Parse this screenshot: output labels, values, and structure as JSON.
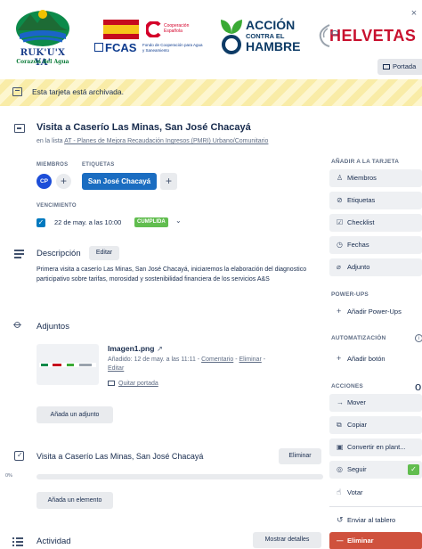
{
  "cover": {
    "logo_rukux_name": "RUK'U'X YA'",
    "logo_rukux_sub": "Corazón del Agua",
    "logo_spain_top": "Cooperación Española",
    "logo_spain_fcas": "FCAS",
    "logo_spain_fcas_sub": "Fondo de Cooperación para Agua y Saneamiento",
    "logo_accion_line1": "ACCIÓN",
    "logo_accion_line2": "CONTRA EL",
    "logo_accion_line3": "HAMBRE",
    "logo_helvetas": "HELVETAS",
    "close_glyph": "×",
    "cover_button": "Portada"
  },
  "archived_banner": "Esta tarjeta está archivada.",
  "card": {
    "title": "Visita a Caserío Las Minas, San José Chacayá",
    "in_list_prefix": "en la lista ",
    "list_name": "AT - Planes de Mejora Recaudación Ingresos (PMRI) Urbano/Comunitario"
  },
  "members": {
    "label": "MIEMBROS",
    "avatar_initials": "CP",
    "add": "+"
  },
  "labels": {
    "label": "ETIQUETAS",
    "tag": "San José Chacayá",
    "tag_color": "#1b6dc1",
    "add": "+"
  },
  "due": {
    "label": "VENCIMIENTO",
    "checked": true,
    "date": "22 de may. a las 10:00",
    "badge": "CUMPLIDA",
    "badge_color": "#61bd4f"
  },
  "description": {
    "title": "Descripción",
    "edit_button": "Editar",
    "text": "Primera visita a caserío Las Minas, San José Chacayá, iniciaremos la elaboración del diagnostico participativo sobre tarifas, morosidad y sostenibilidad financiera de los servicios A&S"
  },
  "attachments": {
    "title": "Adjuntos",
    "file_name": "Imagen1.png",
    "open_icon": "↗",
    "added_text": "Añadido: 12 de may. a las 11:11 - ",
    "comment_link": "Comentario",
    "separator": " - ",
    "delete_link": "Eliminar",
    "after_delete": " -",
    "edit_link": "Editar",
    "remove_cover_link": "Quitar portada",
    "add_button": "Añada un adjunto"
  },
  "checklist": {
    "title": "Visita a Caserío Las Minas, San José Chacayá",
    "delete_button": "Eliminar",
    "progress_label": "0%",
    "progress": 0,
    "add_item_button": "Añada un elemento"
  },
  "activity": {
    "title": "Actividad",
    "show_details_button": "Mostrar detalles"
  },
  "stray_text": "o",
  "sidebar": {
    "add_to_card_heading": "AÑADIR A LA TARJETA",
    "add_to_card": [
      {
        "icon": "person-icon",
        "glyph": "♙",
        "label": "Miembros"
      },
      {
        "icon": "tag-icon",
        "glyph": "⊘",
        "label": "Etiquetas"
      },
      {
        "icon": "checklist-icon",
        "glyph": "☑",
        "label": "Checklist"
      },
      {
        "icon": "clock-icon",
        "glyph": "◷",
        "label": "Fechas"
      },
      {
        "icon": "paperclip-icon",
        "glyph": "⌀",
        "label": "Adjunto"
      }
    ],
    "powerups_heading": "POWER-UPS",
    "powerups_add": "Añadir Power-Ups",
    "automation_heading": "AUTOMATIZACIÓN",
    "automation_info": "i",
    "automation_add": "Añadir botón",
    "actions_heading": "ACCIONES",
    "actions": [
      {
        "icon": "arrow-right-icon",
        "glyph": "→",
        "label": "Mover"
      },
      {
        "icon": "copy-icon",
        "glyph": "⧉",
        "label": "Copiar"
      },
      {
        "icon": "template-icon",
        "glyph": "▣",
        "label": "Convertir en plant..."
      },
      {
        "icon": "eye-icon",
        "glyph": "◎",
        "label": "Seguir"
      },
      {
        "icon": "thumbs-up-icon",
        "glyph": "☝",
        "label": "Votar"
      }
    ],
    "follow_tick": "✓",
    "send_to_board": "Enviar al tablero",
    "send_glyph": "↺",
    "delete": "Eliminar",
    "delete_glyph": "—",
    "delete_color": "#cf513d"
  }
}
